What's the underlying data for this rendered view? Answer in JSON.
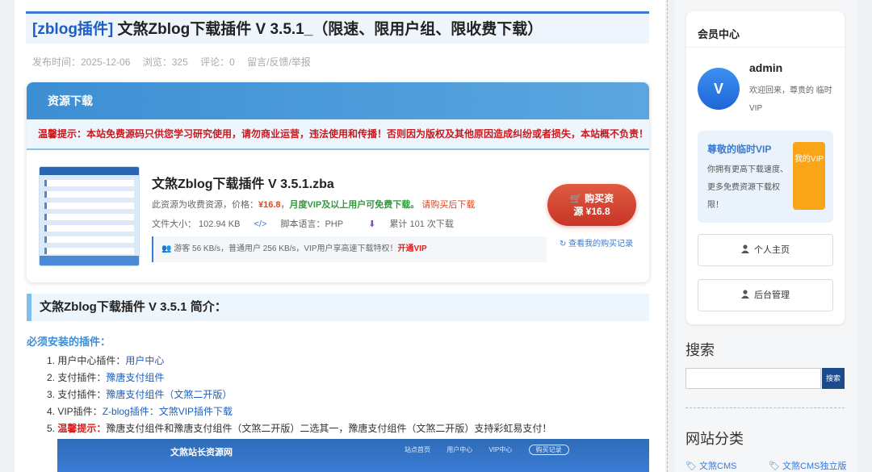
{
  "article": {
    "category": "[zblog插件]",
    "title": " 文煞Zblog下载插件 V 3.5.1_（限速、限用户组、限收费下载）",
    "meta": {
      "publish": "发布时间：2025-12-06",
      "views": "浏览：325",
      "comments": "评论：0",
      "feedback": "留言/反馈/举报"
    }
  },
  "download": {
    "header": "资源下载",
    "warning": "温馨提示：本站免费源码只供您学习研究使用，请勿商业运营，违法使用和传播！否则因为版权及其他原因造成纠纷或者损失，本站概不负责！",
    "file_name": "文煞Zblog下载插件 V 3.5.1.zba",
    "price_prefix": "此资源为收费资源，价格：",
    "price": "¥16.8",
    "vip_free": "月度VIP及以上用户可免费下载。",
    "after_buy": "请购买后下载",
    "size": "文件大小：  102.94 KB",
    "lang": "脚本语言：PHP",
    "count": "累计 101 次下载",
    "speed": "游客 56 KB/s，普通用户 256 KB/s，VIP用户享高速下载特权！",
    "speed_link": "开通VIP",
    "buy_line1": "购买资",
    "buy_line2": "源 ¥16.8",
    "records": "查看我的购买记录"
  },
  "intro": {
    "heading": "文煞Zblog下载插件 V 3.5.1 简介：",
    "required": "必须安装的插件：",
    "items": [
      {
        "label": "1. 用户中心插件：",
        "link": "用户中心"
      },
      {
        "label": "2. 支付插件：",
        "link": "豫唐支付组件"
      },
      {
        "label": "3. 支付插件：",
        "link": "豫唐支付组件（文煞二开版）"
      },
      {
        "label": "4. VIP插件：",
        "link": "Z-blog插件：文煞VIP插件下载"
      }
    ],
    "note_num": "5. ",
    "note_hl": "温馨提示：",
    "note_text": "豫唐支付组件和豫唐支付组件（文煞二开版）二选其一，豫唐支付组件（文煞二开版）支持彩虹易支付！",
    "screenshot": {
      "brand": "文煞站长资源网",
      "nav": [
        "站点首页",
        "用户中心",
        "VIP中心",
        "购买记录"
      ]
    }
  },
  "sidebar": {
    "member_title": "会员中心",
    "avatar_letter": "V",
    "username": "admin",
    "welcome": "欢迎回来，尊贵的 临时VIP",
    "vip_title": "尊敬的临时VIP",
    "vip_desc": "你拥有更高下载速度、更多免费资源下载权限！",
    "vip_btn": "我的VIP",
    "home_btn": "个人主页",
    "admin_btn": "后台管理",
    "search_title": "搜索",
    "search_placeholder": "",
    "search_btn": "搜索",
    "cat_title": "网站分类",
    "cats": [
      "文煞CMS",
      "文煞CMS独立版"
    ]
  },
  "colors": {
    "accent": "#3a7bd5",
    "warning": "#c8191e",
    "price": "#e0451b",
    "vip": "#f8a518"
  }
}
